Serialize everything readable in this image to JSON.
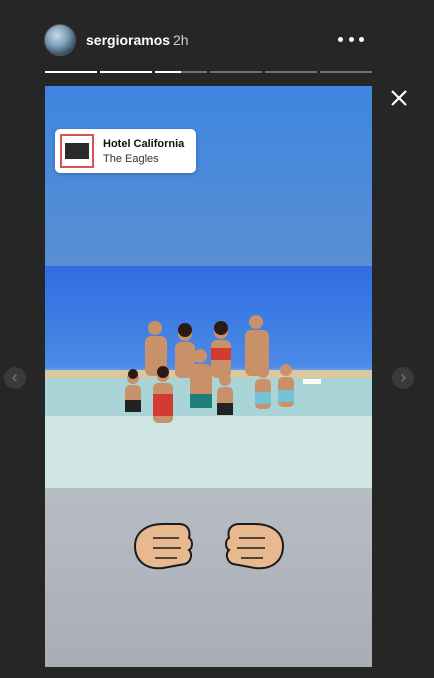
{
  "header": {
    "username": "sergioramos",
    "time": "2h",
    "progress_segments_total": 6,
    "progress_segments_done": 2.5
  },
  "music_sticker": {
    "song": "Hotel California",
    "artist": "The Eagles"
  },
  "icons": {
    "more": "more-options-icon",
    "close": "close-icon",
    "prev": "chevron-left-icon",
    "next": "chevron-right-icon",
    "sticker": "fist-bump-icon"
  },
  "colors": {
    "background": "#262626",
    "sky": "#3f86e0",
    "sticker_border": "#d9534f"
  }
}
